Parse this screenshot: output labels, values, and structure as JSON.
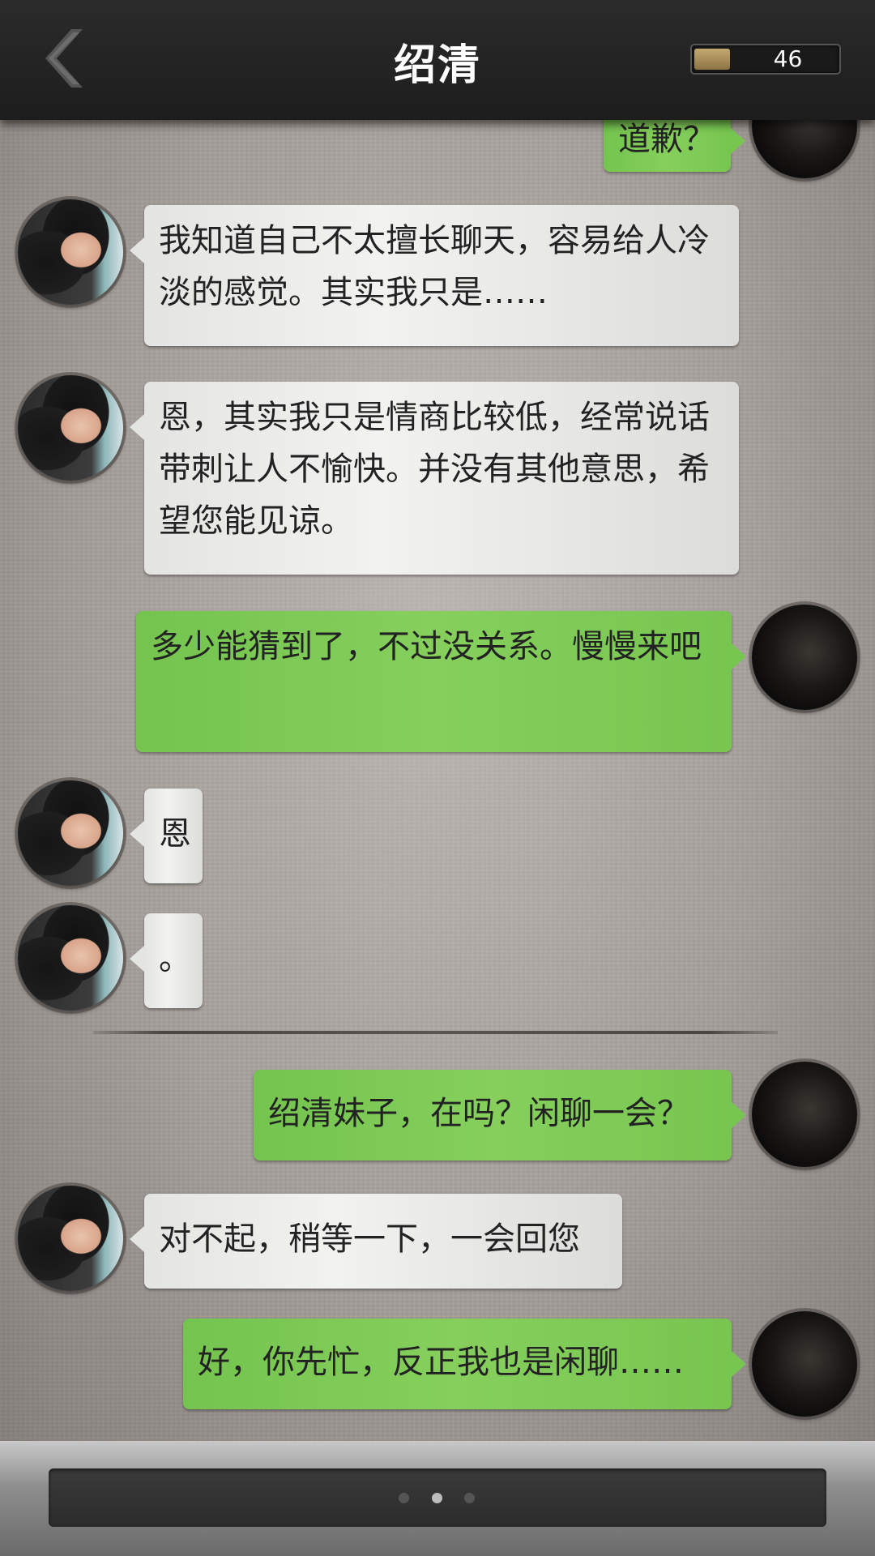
{
  "header": {
    "title": "绍清",
    "coins": "46",
    "coin_level": 0.25
  },
  "messages": [
    {
      "id": 0,
      "side": "out",
      "text": "道歉？"
    },
    {
      "id": 1,
      "side": "in",
      "text": "我知道自己不太擅长聊天，容易给人冷淡的感觉。其实我只是……"
    },
    {
      "id": 2,
      "side": "in",
      "text": "恩，其实我只是情商比较低，经常说话带刺让人不愉快。并没有其他意思，希望您能见谅。"
    },
    {
      "id": 3,
      "side": "out",
      "text": "多少能猜到了，不过没关系。慢慢来吧"
    },
    {
      "id": 4,
      "side": "in",
      "text": "恩"
    },
    {
      "id": 5,
      "side": "in",
      "text": "。"
    },
    {
      "id": 6,
      "side": "out",
      "text": "绍清妹子，在吗？闲聊一会？"
    },
    {
      "id": 7,
      "side": "in",
      "text": "对不起，稍等一下，一会回您"
    },
    {
      "id": 8,
      "side": "out",
      "text": "好，你先忙，反正我也是闲聊……"
    }
  ],
  "pager": {
    "count": 3,
    "active_index": 1
  },
  "colors": {
    "header": "#222222",
    "incoming_bubble": "#ececea",
    "outgoing_bubble": "#7fcb56",
    "coin_fill": "#b1955e"
  },
  "icons": {
    "back": "chevron-left-icon",
    "coin": "coin-icon"
  }
}
